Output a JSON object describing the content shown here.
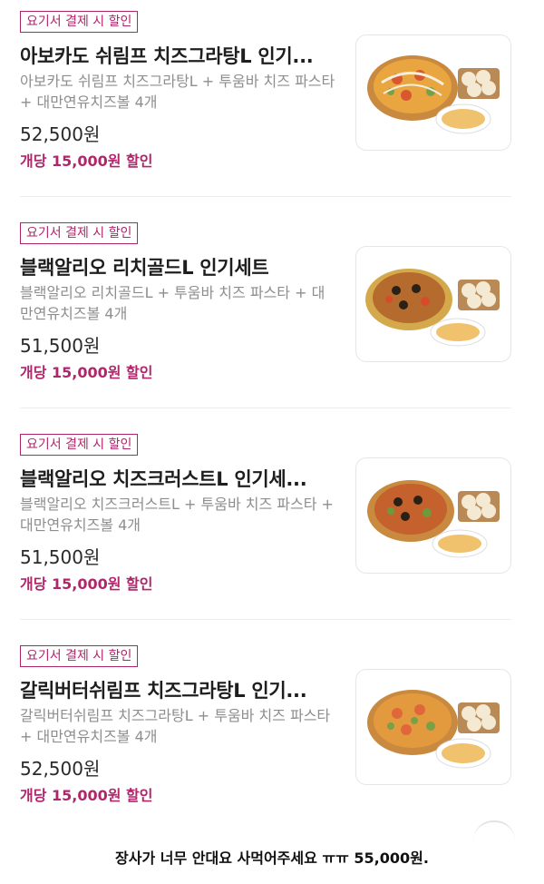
{
  "products": [
    {
      "badge": "요기서 결제 시 할인",
      "title": "아보카도 쉬림프 치즈그라탕L 인기...",
      "description": "아보카도 쉬림프 치즈그라탕L + 투움바 치즈 파스타 + 대만연유치즈볼 4개",
      "price": "52,500원",
      "discount": "개당 15,000원 할인",
      "image_icon": "pizza-set-image"
    },
    {
      "badge": "요기서 결제 시 할인",
      "title": "블랙알리오 리치골드L 인기세트",
      "description": "블랙알리오 리치골드L + 투움바 치즈 파스타 + 대만연유치즈볼 4개",
      "price": "51,500원",
      "discount": "개당 15,000원 할인",
      "image_icon": "pizza-set-image"
    },
    {
      "badge": "요기서 결제 시 할인",
      "title": "블랙알리오 치즈크러스트L  인기세...",
      "description": "블랙알리오 치즈크러스트L + 투움바 치즈 파스타 + 대만연유치즈볼 4개",
      "price": "51,500원",
      "discount": "개당 15,000원 할인",
      "image_icon": "pizza-set-image"
    },
    {
      "badge": "요기서 결제 시 할인",
      "title": "갈릭버터쉬림프 치즈그라탕L 인기...",
      "description": "갈릭버터쉬림프 치즈그라탕L + 투움바 치즈 파스타 + 대만연유치즈볼 4개",
      "price": "52,500원",
      "discount": "개당 15,000원 할인",
      "image_icon": "pizza-set-image"
    }
  ],
  "caption": "장사가 너무 안대요 사먹어주세요 ㅠㅠ 55,000원.",
  "colors": {
    "accent": "#b0266b",
    "price": "#2a2a2a",
    "desc": "#8e8e8e"
  }
}
